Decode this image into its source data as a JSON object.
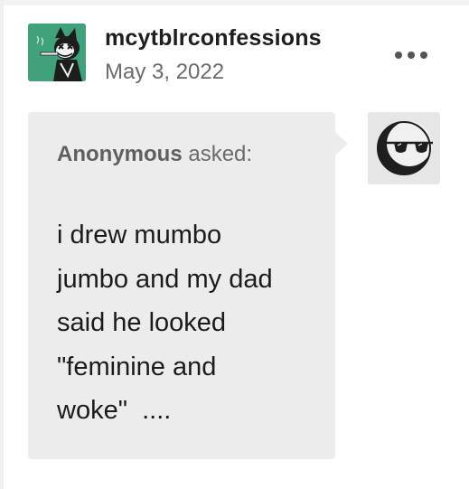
{
  "post": {
    "blog_name": "mcytblrconfessions",
    "date": "May 3, 2022",
    "avatar_icon": "cartoon-cat-avatar-icon",
    "avatar_bg": "#3fa27a",
    "more_icon": "ellipsis-icon"
  },
  "ask": {
    "asker_name": "Anonymous",
    "asked_label": "asked:",
    "question_lines": [
      "i drew mumbo",
      "jumbo and my dad",
      "said he looked",
      "\"feminine and",
      "woke\"  ...."
    ],
    "anon_avatar_icon": "anonymous-sunglasses-icon",
    "bubble_color": "#ececec"
  }
}
